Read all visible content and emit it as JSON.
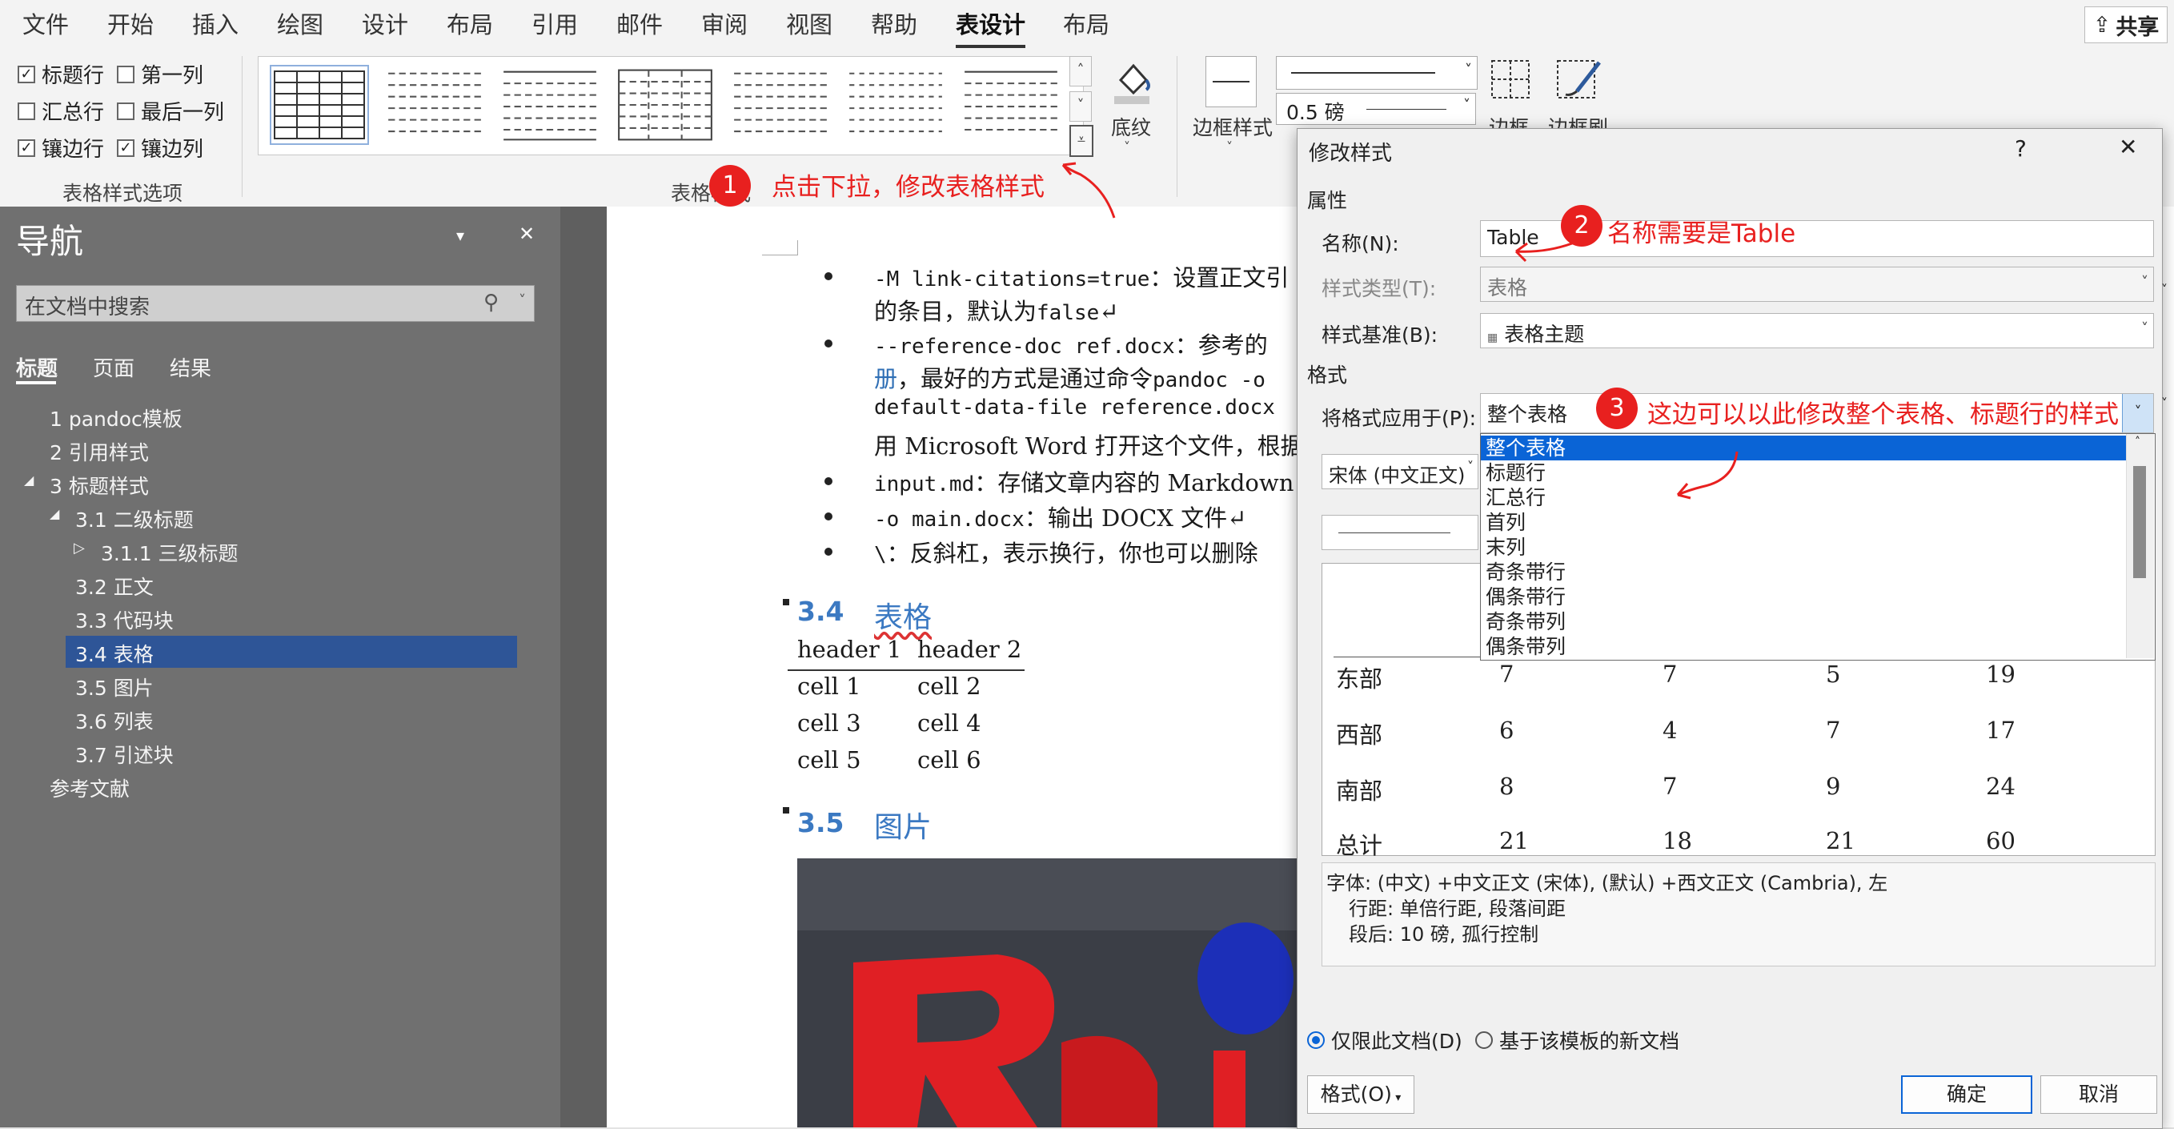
{
  "ribbon": {
    "tabs": [
      "文件",
      "开始",
      "插入",
      "绘图",
      "设计",
      "布局",
      "引用",
      "邮件",
      "审阅",
      "视图",
      "帮助",
      "表设计",
      "布局"
    ],
    "active_tab": "表设计",
    "share_label": "共享",
    "style_options": {
      "header_row": "标题行",
      "first_column": "第一列",
      "total_row": "汇总行",
      "last_column": "最后一列",
      "banded_rows": "镶边行",
      "banded_columns": "镶边列",
      "group_label": "表格样式选项"
    },
    "table_styles_group_label": "表格样式",
    "shading_label": "底纹",
    "border_styles_label": "边框样式",
    "line_weight": "0.5 磅",
    "borders_label": "边框",
    "border_painter_label": "边框刷"
  },
  "navigation": {
    "title": "导航",
    "search_placeholder": "在文档中搜索",
    "tabs": [
      "标题",
      "页面",
      "结果"
    ],
    "items": [
      {
        "label": "1 pandoc模板"
      },
      {
        "label": "2 引用样式"
      },
      {
        "label": "3 标题样式"
      },
      {
        "label": "3.1 二级标题"
      },
      {
        "label": "3.1.1 三级标题"
      },
      {
        "label": "3.2 正文"
      },
      {
        "label": "3.3 代码块"
      },
      {
        "label": "3.4 表格"
      },
      {
        "label": "3.5 图片"
      },
      {
        "label": "3.6 列表"
      },
      {
        "label": "3.7 引述块"
      },
      {
        "label": "参考文献"
      }
    ]
  },
  "document": {
    "bullets": {
      "b1_code": "-M link-citations=true",
      "b1_text": "：设置正文引",
      "b1_line2a": "的条目，默认为",
      "b1_line2b": "false",
      "b2_code": "--reference-doc ref.docx",
      "b2_text": "：参考的",
      "b2_line2a": "册",
      "b2_line2b": "，最好的方式是通过命令",
      "b2_line2c": "pandoc -o",
      "b2_line3": "default-data-file reference.docx",
      "b2_line4": "用 Microsoft Word 打开这个文件，根据",
      "b3_code": "input.md",
      "b3_text": "：存储文章内容的 Markdown",
      "b4_code": "-o main.docx",
      "b4_text": "：输出 DOCX 文件",
      "b5_code": "\\",
      "b5_text": "：反斜杠，表示换行，你也可以删除"
    },
    "section_34_num": "3.4",
    "section_34_title": "表格",
    "table": {
      "headers": [
        "header 1",
        "header 2"
      ],
      "rows": [
        [
          "cell 1",
          "cell 2"
        ],
        [
          "cell 3",
          "cell 4"
        ],
        [
          "cell 5",
          "cell 6"
        ]
      ]
    },
    "section_35_num": "3.5",
    "section_35_title": "图片"
  },
  "annotations": {
    "a1_num": "1",
    "a1_text": "点击下拉，修改表格样式",
    "a2_num": "2",
    "a2_text": "名称需要是Table",
    "a3_num": "3",
    "a3_text": "这边可以以此修改整个表格、标题行的样式"
  },
  "dialog": {
    "title": "修改样式",
    "help": "?",
    "close": "✕",
    "properties_label": "属性",
    "name_label": "名称(N):",
    "name_value": "Table",
    "style_type_label": "样式类型(T):",
    "style_type_value": "表格",
    "based_on_label": "样式基准(B):",
    "based_on_value": "表格主题",
    "format_label": "格式",
    "apply_to_label": "将格式应用于(P):",
    "apply_to_value": "整个表格",
    "font_value": "宋体 (中文正文)",
    "dropdown_options": [
      "整个表格",
      "标题行",
      "汇总行",
      "首列",
      "末列",
      "奇条带行",
      "偶条带行",
      "奇条带列",
      "偶条带列"
    ],
    "preview_rows": [
      [
        "东部",
        "7",
        "7",
        "5",
        "19"
      ],
      [
        "西部",
        "6",
        "4",
        "7",
        "17"
      ],
      [
        "南部",
        "8",
        "7",
        "9",
        "24"
      ],
      [
        "总计",
        "21",
        "18",
        "21",
        "60"
      ]
    ],
    "description_line1": "字体: (中文) +中文正文 (宋体), (默认) +西文正文 (Cambria), 左",
    "description_line2": "行距: 单倍行距, 段落间距",
    "description_line3": "段后: 10 磅, 孤行控制",
    "radio_this_doc": "仅限此文档(D)",
    "radio_template": "基于该模板的新文档",
    "format_button": "格式(O)",
    "ok_button": "确定",
    "cancel_button": "取消"
  }
}
